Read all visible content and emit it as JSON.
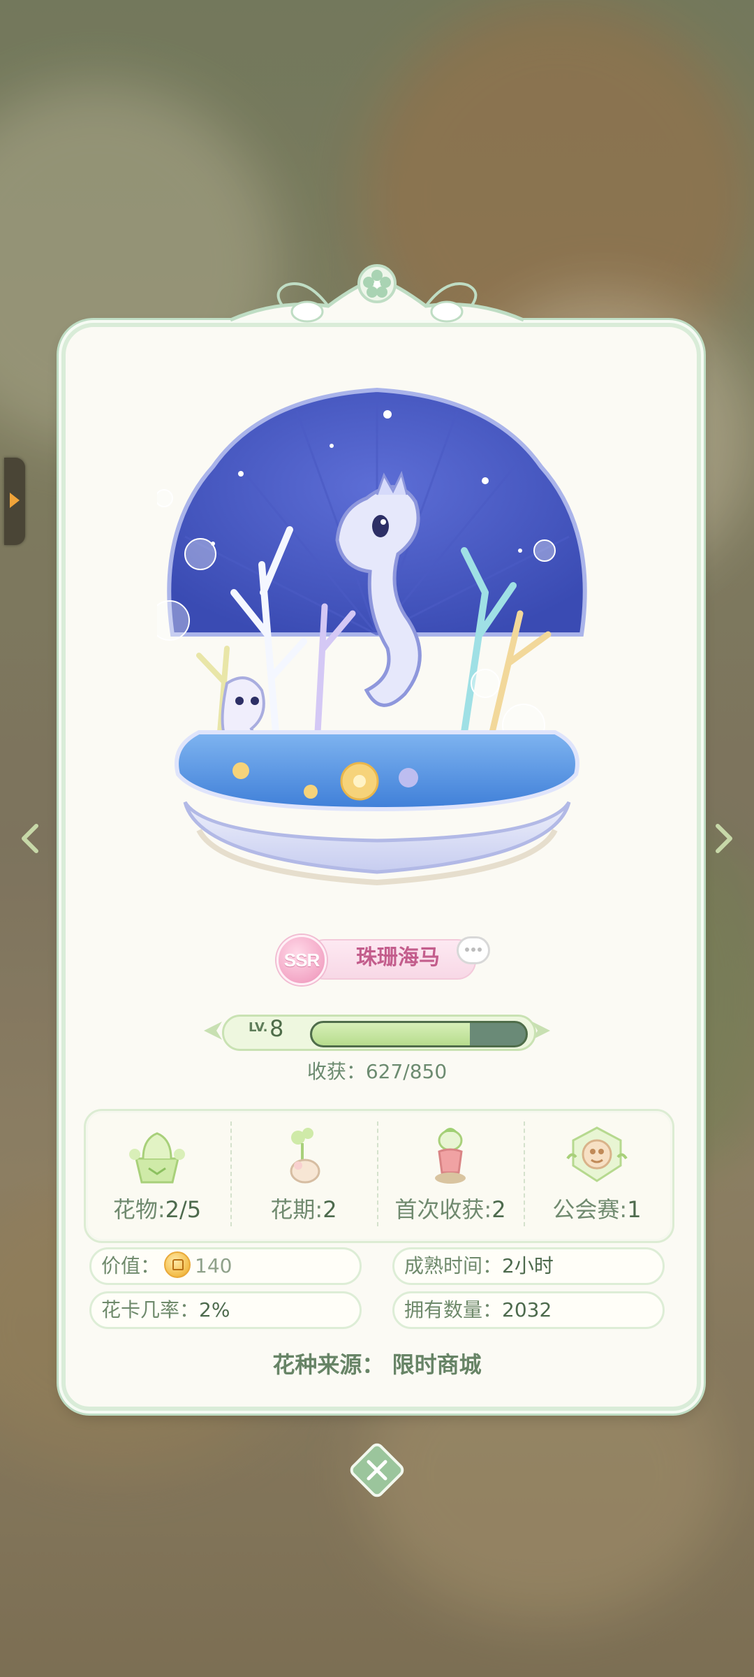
{
  "flower": {
    "rarity": "SSR",
    "name": "珠珊海马"
  },
  "level": {
    "prefix": "LV.",
    "value": "8",
    "progress_fraction": 0.74
  },
  "harvest": {
    "text": "收获：627/850"
  },
  "stats": [
    {
      "label": "花物:",
      "value": "2/5",
      "icon": "flower-pot-icon"
    },
    {
      "label": "花期:",
      "value": "2",
      "icon": "sprout-icon"
    },
    {
      "label": "首次收获:",
      "value": "2",
      "icon": "seedling-figure-icon"
    },
    {
      "label": "公会赛:",
      "value": "1",
      "icon": "guild-crest-icon"
    }
  ],
  "info": {
    "value_label": "价值：",
    "value_amount": "140",
    "mature_label": "成熟时间：",
    "mature_value": "2小时",
    "card_rate_label": "花卡几率：",
    "card_rate_value": "2%",
    "owned_label": "拥有数量：",
    "owned_value": "2032"
  },
  "source": {
    "text": "花种来源：  限时商城"
  },
  "colors": {
    "card_bg": "#fbfaf4",
    "card_border": "#bfddc4",
    "text_green": "#6f8a6c",
    "name_pink": "#c35d8c",
    "progress_fill": "#b7dc8d"
  }
}
